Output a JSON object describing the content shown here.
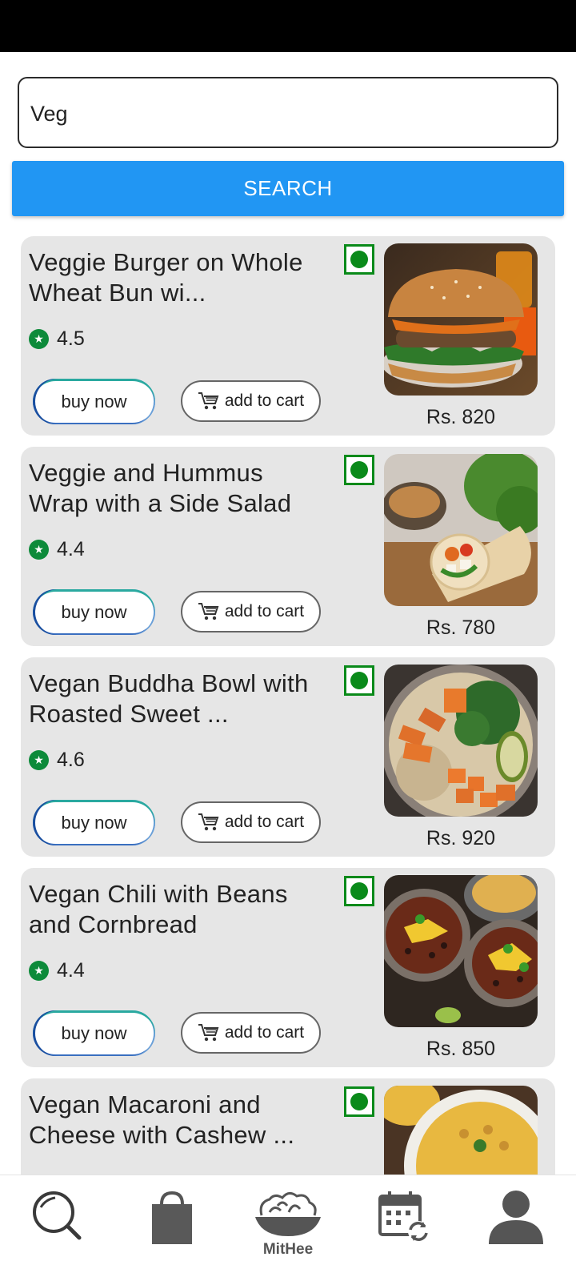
{
  "search": {
    "value": "Veg",
    "button_label": "SEARCH"
  },
  "items": [
    {
      "title": "Veggie Burger on Whole Wheat Bun wi...",
      "rating": "4.5",
      "price": "Rs. 820",
      "buy_label": "buy now",
      "cart_label": "add to cart",
      "image": "veggie-burger"
    },
    {
      "title": "Veggie and Hummus Wrap with a Side Salad",
      "rating": "4.4",
      "price": "Rs. 780",
      "buy_label": "buy now",
      "cart_label": "add to cart",
      "image": "hummus-wrap"
    },
    {
      "title": "Vegan Buddha Bowl with Roasted Sweet ...",
      "rating": "4.6",
      "price": "Rs. 920",
      "buy_label": "buy now",
      "cart_label": "add to cart",
      "image": "buddha-bowl"
    },
    {
      "title": "Vegan Chili with Beans and Cornbread",
      "rating": "4.4",
      "price": "Rs. 850",
      "buy_label": "buy now",
      "cart_label": "add to cart",
      "image": "vegan-chili"
    },
    {
      "title": "Vegan Macaroni and Cheese with Cashew ...",
      "rating": "",
      "price": "",
      "buy_label": "",
      "cart_label": "",
      "image": "mac-and-cheese"
    }
  ],
  "nav": {
    "items": [
      {
        "icon": "search-icon"
      },
      {
        "icon": "shopping-bag-icon"
      },
      {
        "icon": "salad-bowl-icon",
        "label": "MitHee"
      },
      {
        "icon": "calendar-refresh-icon"
      },
      {
        "icon": "profile-icon"
      }
    ]
  },
  "colors": {
    "accent": "#2196f3",
    "veg": "#0a8a1a",
    "rating": "#0d8a3a",
    "card": "#e6e6e6"
  }
}
